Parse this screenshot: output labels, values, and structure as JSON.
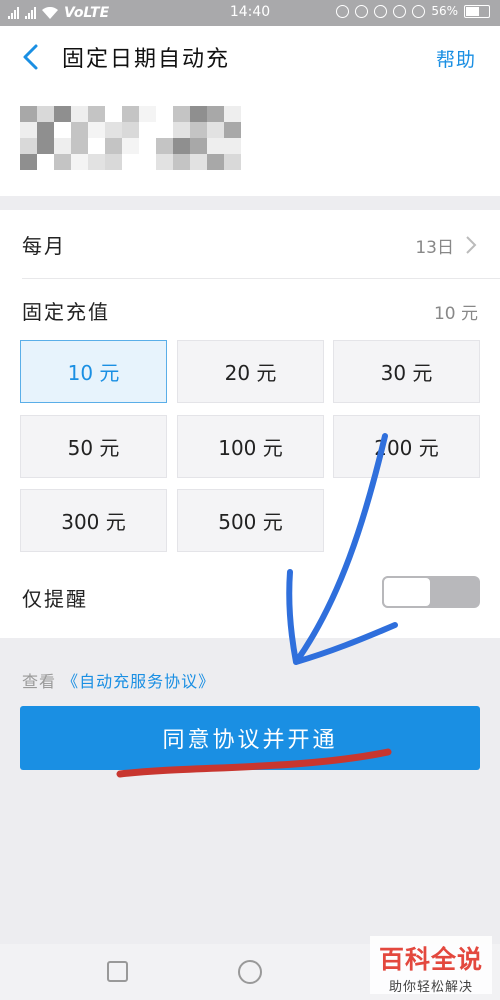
{
  "status_bar": {
    "network": "VoLTE",
    "time": "14:40",
    "battery": "56%"
  },
  "header": {
    "title": "固定日期自动充",
    "help_label": "帮助"
  },
  "settings": {
    "monthly_label": "每月",
    "monthly_value": "13日",
    "fixed_amount_label": "固定充值",
    "fixed_amount_value": "10 元",
    "amounts": [
      "10 元",
      "20 元",
      "30 元",
      "50 元",
      "100 元",
      "200 元",
      "300 元",
      "500 元"
    ],
    "selected_amount": "10 元",
    "reminder_label": "仅提醒",
    "reminder_on": false
  },
  "agreement": {
    "prefix": "查看",
    "link": "《自动充服务协议》"
  },
  "primary_button": "同意协议并开通",
  "watermark": {
    "main": "百科全说",
    "sub": "助你轻松解决"
  },
  "colors": {
    "accent": "#1a8fe3",
    "status_bar": "#a9a9ab",
    "annotation_arrow": "#2f6fdc",
    "annotation_underline": "#c8362f"
  },
  "icons": [
    "back-arrow-icon",
    "chevron-right-icon",
    "signal-icon",
    "wifi-icon",
    "battery-icon",
    "square-key-icon",
    "circle-key-icon"
  ]
}
